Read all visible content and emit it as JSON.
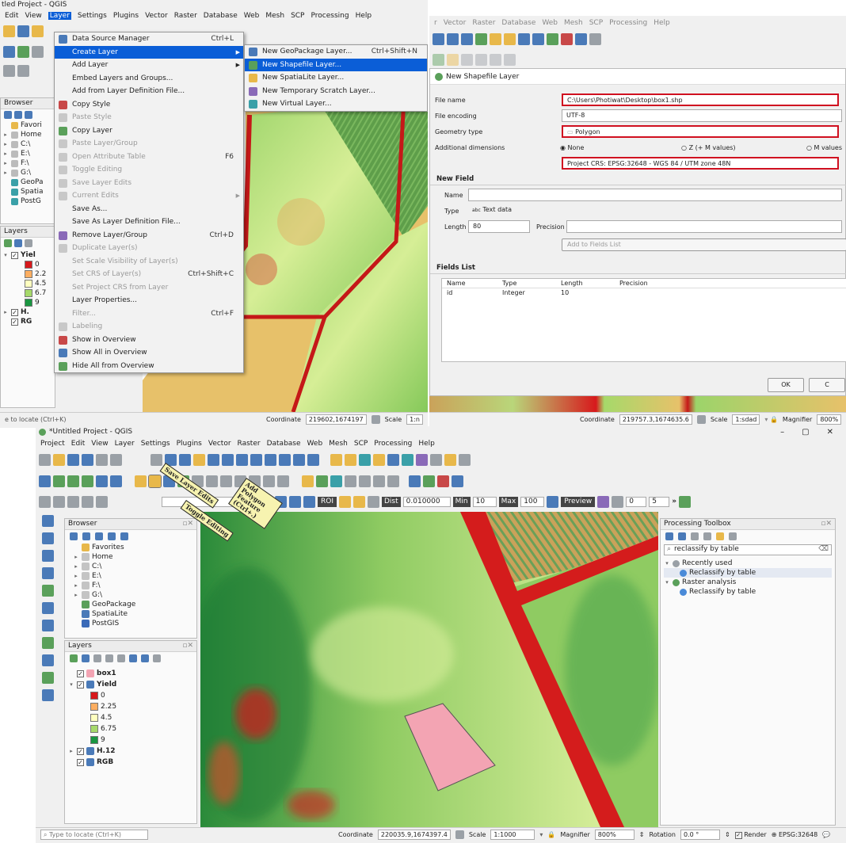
{
  "top_left": {
    "title": "tled Project - QGIS",
    "menu": [
      "Edit",
      "View",
      "Layer",
      "Settings",
      "Plugins",
      "Vector",
      "Raster",
      "Database",
      "Web",
      "Mesh",
      "SCP",
      "Processing",
      "Help"
    ],
    "browser_title": "Browser",
    "browser_items": [
      "Favori",
      "Home",
      "C:\\",
      "E:\\",
      "F:\\",
      "G:\\",
      "GeoPa",
      "Spatia",
      "PostG"
    ],
    "layers_title": "Layers",
    "layers": [
      "Yiel",
      "0",
      "2.2",
      "4.5",
      "6.7",
      "9",
      "H.",
      "RG"
    ],
    "locate_placeholder": "e to locate (Ctrl+K)",
    "coordinate_label": "Coordinate",
    "coordinate": "219602,1674197",
    "scale_label": "Scale",
    "scale": "1:n",
    "layer_menu": [
      {
        "label": "Data Source Manager",
        "shortcut": "Ctrl+L",
        "state": "normal",
        "icon": "data-source-icon"
      },
      {
        "label": "Create Layer",
        "shortcut": "",
        "state": "highlighted",
        "icon": "",
        "submenu": true
      },
      {
        "label": "Add Layer",
        "shortcut": "",
        "state": "normal",
        "icon": "",
        "submenu": true
      },
      {
        "label": "Embed Layers and Groups...",
        "shortcut": "",
        "state": "normal",
        "icon": ""
      },
      {
        "label": "Add from Layer Definition File...",
        "shortcut": "",
        "state": "normal",
        "icon": ""
      },
      {
        "label": "Copy Style",
        "shortcut": "",
        "state": "normal",
        "icon": "copy-style-icon"
      },
      {
        "label": "Paste Style",
        "shortcut": "",
        "state": "disabled",
        "icon": "paste-style-icon"
      },
      {
        "label": "Copy Layer",
        "shortcut": "",
        "state": "normal",
        "icon": "copy-layer-icon"
      },
      {
        "label": "Paste Layer/Group",
        "shortcut": "",
        "state": "disabled",
        "icon": "paste-layer-icon"
      },
      {
        "label": "Open Attribute Table",
        "shortcut": "F6",
        "state": "disabled",
        "icon": "attribute-table-icon"
      },
      {
        "label": "Toggle Editing",
        "shortcut": "",
        "state": "disabled",
        "icon": "pencil-icon"
      },
      {
        "label": "Save Layer Edits",
        "shortcut": "",
        "state": "disabled",
        "icon": "save-edits-icon"
      },
      {
        "label": "Current Edits",
        "shortcut": "",
        "state": "disabled",
        "icon": "current-edits-icon",
        "submenu": true
      },
      {
        "label": "Save As...",
        "shortcut": "",
        "state": "normal",
        "icon": ""
      },
      {
        "label": "Save As Layer Definition File...",
        "shortcut": "",
        "state": "normal",
        "icon": ""
      },
      {
        "label": "Remove Layer/Group",
        "shortcut": "Ctrl+D",
        "state": "normal",
        "icon": "remove-layer-icon"
      },
      {
        "label": "Duplicate Layer(s)",
        "shortcut": "",
        "state": "disabled",
        "icon": "duplicate-icon"
      },
      {
        "label": "Set Scale Visibility of Layer(s)",
        "shortcut": "",
        "state": "disabled",
        "icon": ""
      },
      {
        "label": "Set CRS of Layer(s)",
        "shortcut": "Ctrl+Shift+C",
        "state": "disabled",
        "icon": ""
      },
      {
        "label": "Set Project CRS from Layer",
        "shortcut": "",
        "state": "disabled",
        "icon": ""
      },
      {
        "label": "Layer Properties...",
        "shortcut": "",
        "state": "normal",
        "icon": ""
      },
      {
        "label": "Filter...",
        "shortcut": "Ctrl+F",
        "state": "disabled",
        "icon": ""
      },
      {
        "label": "Labeling",
        "shortcut": "",
        "state": "disabled",
        "icon": "labeling-icon"
      },
      {
        "label": "Show in Overview",
        "shortcut": "",
        "state": "normal",
        "icon": "overview-icon"
      },
      {
        "label": "Show All in Overview",
        "shortcut": "",
        "state": "normal",
        "icon": "overview-all-icon"
      },
      {
        "label": "Hide All from Overview",
        "shortcut": "",
        "state": "normal",
        "icon": "overview-hide-icon"
      }
    ],
    "create_submenu": [
      {
        "label": "New GeoPackage Layer...",
        "shortcut": "Ctrl+Shift+N",
        "state": "normal",
        "icon": "geopackage-icon"
      },
      {
        "label": "New Shapefile Layer...",
        "shortcut": "",
        "state": "highlighted",
        "icon": "shapefile-icon"
      },
      {
        "label": "New SpatiaLite Layer...",
        "shortcut": "",
        "state": "normal",
        "icon": "spatialite-icon"
      },
      {
        "label": "New Temporary Scratch Layer...",
        "shortcut": "",
        "state": "normal",
        "icon": "scratch-icon"
      },
      {
        "label": "New Virtual Layer...",
        "shortcut": "",
        "state": "normal",
        "icon": "virtual-icon"
      }
    ]
  },
  "top_right": {
    "menu": [
      "r",
      "Vector",
      "Raster",
      "Database",
      "Web",
      "Mesh",
      "SCP",
      "Processing",
      "Help"
    ],
    "dialog_title": "New Shapefile Layer",
    "file_name_label": "File name",
    "file_name": "C:\\Users\\Photiwat\\Desktop\\box1.shp",
    "file_encoding_label": "File encoding",
    "file_encoding": "UTF-8",
    "geometry_type_label": "Geometry type",
    "geometry_type": "Polygon",
    "additional_dimensions_label": "Additional dimensions",
    "dim_none": "None",
    "dim_z": "Z (+ M values)",
    "dim_m": "M values",
    "crs": "Project CRS: EPSG:32648 - WGS 84 / UTM zone 48N",
    "new_field_title": "New Field",
    "name_label": "Name",
    "type_label": "Type",
    "type_value": "Text data",
    "type_icon_text": "abc",
    "length_label": "Length",
    "length_value": "80",
    "precision_label": "Precision",
    "add_fields_button": "Add to Fields List",
    "fields_list_title": "Fields List",
    "fields_columns": [
      "Name",
      "Type",
      "Length",
      "Precision"
    ],
    "fields_rows": [
      [
        "id",
        "Integer",
        "10",
        ""
      ]
    ],
    "ok_button": "OK",
    "cancel_button": "C",
    "coordinate_label": "Coordinate",
    "coordinate": "219757.3,1674635.6",
    "scale_label": "Scale",
    "scale": "1:sdad",
    "magnifier_label": "Magnifier",
    "magnifier": "800%"
  },
  "bottom": {
    "title": "*Untitled Project - QGIS",
    "menu": [
      "Project",
      "Edit",
      "View",
      "Layer",
      "Settings",
      "Plugins",
      "Vector",
      "Raster",
      "Database",
      "Web",
      "Mesh",
      "SCP",
      "Processing",
      "Help"
    ],
    "scp_roi": "ROI",
    "scp_dist_label": "Dist",
    "scp_dist": "0.010000",
    "scp_min_label": "Min",
    "scp_min": "10",
    "scp_max_label": "Max",
    "scp_max": "100",
    "scp_preview": "Preview",
    "scp_field_1": "0",
    "scp_field_2": "5",
    "browser_title": "Browser",
    "browser_items": [
      "Favorites",
      "Home",
      "C:\\",
      "E:\\",
      "F:\\",
      "G:\\",
      "GeoPackage",
      "SpatiaLite",
      "PostGIS"
    ],
    "layers_title": "Layers",
    "layers": [
      {
        "label": "box1",
        "bold": true,
        "checked": true,
        "indent": 0,
        "kind": "polygon"
      },
      {
        "label": "Yield",
        "bold": true,
        "checked": true,
        "indent": 0,
        "kind": "raster",
        "expanded": true
      },
      {
        "label": "0",
        "bold": false,
        "indent": 2,
        "kind": "swatch",
        "color": "#d7191c"
      },
      {
        "label": "2.25",
        "bold": false,
        "indent": 2,
        "kind": "swatch",
        "color": "#fdae61"
      },
      {
        "label": "4.5",
        "bold": false,
        "indent": 2,
        "kind": "swatch",
        "color": "#ffffbf"
      },
      {
        "label": "6.75",
        "bold": false,
        "indent": 2,
        "kind": "swatch",
        "color": "#a6d96a"
      },
      {
        "label": "9",
        "bold": false,
        "indent": 2,
        "kind": "swatch",
        "color": "#1a9641"
      },
      {
        "label": "H.12",
        "bold": true,
        "checked": true,
        "indent": 0,
        "kind": "raster"
      },
      {
        "label": "RGB",
        "bold": true,
        "checked": true,
        "indent": 0,
        "kind": "raster"
      }
    ],
    "processing_title": "Processing Toolbox",
    "processing_search": "reclassify by table",
    "processing_tree": [
      {
        "label": "Recently used",
        "indent": 0,
        "icon": "clock-icon"
      },
      {
        "label": "Reclassify by table",
        "indent": 2,
        "icon": "gear-icon"
      },
      {
        "label": "Raster analysis",
        "indent": 0,
        "icon": "qgis-icon"
      },
      {
        "label": "Reclassify by table",
        "indent": 2,
        "icon": "gear-icon"
      }
    ],
    "callout_save": "Save Layer Edits",
    "callout_toggle": "Toggle Editing",
    "callout_add_polygon": "Add Polygon Feature (Ctrl+.)",
    "locate_placeholder": "Type to locate (Ctrl+K)",
    "coordinate_label": "Coordinate",
    "coordinate": "220035.9,1674397.4",
    "scale_label": "Scale",
    "scale": "1:1000",
    "magnifier_label": "Magnifier",
    "magnifier": "800%",
    "rotation_label": "Rotation",
    "rotation": "0.0 °",
    "render_label": "Render",
    "crs": "EPSG:32648"
  }
}
